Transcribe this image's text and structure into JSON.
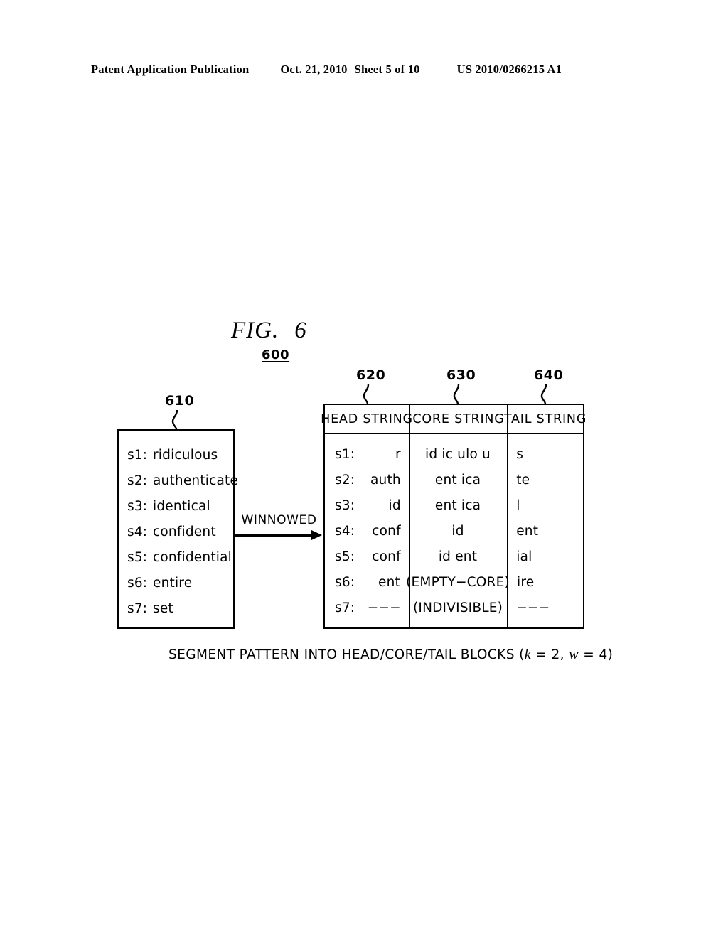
{
  "header": {
    "publication": "Patent Application Publication",
    "date": "Oct. 21, 2010",
    "sheet": "Sheet 5 of 10",
    "patent_number": "US 2010/0266215 A1"
  },
  "figure": {
    "title_label": "FIG.",
    "title_number": "6",
    "figure_ref": "600"
  },
  "callouts": {
    "source_box": "610",
    "head_string": "620",
    "core_string": "630",
    "tail_string": "640"
  },
  "source_box": {
    "rows": [
      {
        "label": "s1:",
        "value": "ridiculous"
      },
      {
        "label": "s2:",
        "value": "authenticate"
      },
      {
        "label": "s3:",
        "value": "identical"
      },
      {
        "label": "s4:",
        "value": "confident"
      },
      {
        "label": "s5:",
        "value": "confidential"
      },
      {
        "label": "s6:",
        "value": "entire"
      },
      {
        "label": "s7:",
        "value": "set"
      }
    ]
  },
  "arrow": {
    "label": "WINNOWED"
  },
  "table": {
    "columns": [
      "HEAD STRING",
      "CORE STRING",
      "TAIL STRING"
    ],
    "rows": [
      {
        "label": "s1:",
        "head": "r",
        "core": "id ic ulo u",
        "tail": "s"
      },
      {
        "label": "s2:",
        "head": "auth",
        "core": "ent ica",
        "tail": "te"
      },
      {
        "label": "s3:",
        "head": "id",
        "core": "ent ica",
        "tail": "l"
      },
      {
        "label": "s4:",
        "head": "conf",
        "core": "id",
        "tail": "ent"
      },
      {
        "label": "s5:",
        "head": "conf",
        "core": "id ent",
        "tail": "ial"
      },
      {
        "label": "s6:",
        "head": "ent",
        "core": "(EMPTY−CORE)",
        "tail": "ire"
      },
      {
        "label": "s7:",
        "head": "−−−",
        "core": "(INDIVISIBLE)",
        "tail": "−−−"
      }
    ]
  },
  "caption": {
    "text_before": "SEGMENT PATTERN INTO HEAD/CORE/TAIL BLOCKS (",
    "var_k": "k",
    "mid_1": " = 2, ",
    "var_w": "w",
    "mid_2": " = 4)"
  }
}
